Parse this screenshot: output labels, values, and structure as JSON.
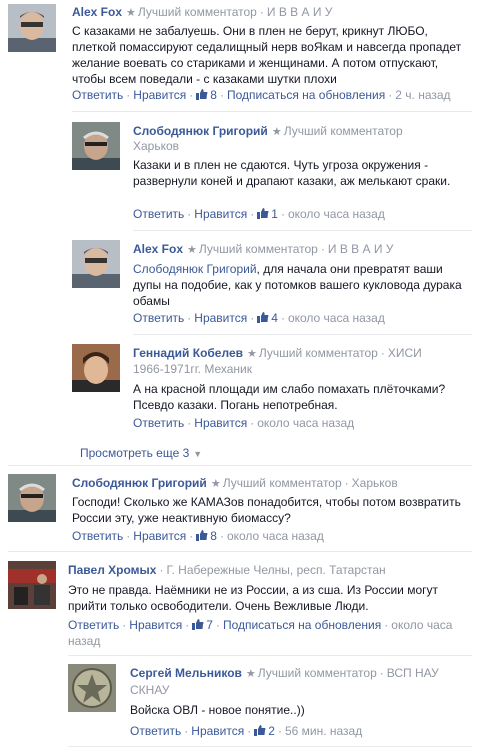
{
  "common": {
    "reply": "Ответить",
    "like": "Нравится",
    "subscribe": "Подписаться на обновления",
    "top_commenter": "Лучший комментатор",
    "dot": "·"
  },
  "comments": [
    {
      "name": "Alex Fox",
      "affiliation": "И В В А И У",
      "text": "С казаками не забалуешь. Они в плен не берут, крикнут ЛЮБО, плеткой помассируют седалищный нерв воЯкам и навсегда пропадет желание воевать со стариками и женщинами. А потом отпускают, чтобы всем поведали - с казаками шутки плохи",
      "likes": "8",
      "time": "2 ч. назад",
      "replies": [
        {
          "name": "Слободянюк Григорий",
          "location": "Харьков",
          "text": "Казаки и в плен не сдаются. Чуть угроза окружения - развернули коней и драпают казаки, аж мелькают сраки.",
          "likes": "1",
          "time": "около часа назад"
        },
        {
          "name": "Alex Fox",
          "affiliation": "И В В А И У",
          "mention": "Слободянюк Григорий",
          "text": ", для начала они превратят ваши дупы на подобие, как у потомков вашего кукловода дурака обамы",
          "likes": "4",
          "time": "около часа назад"
        },
        {
          "name": "Геннадий Кобелев",
          "affiliation": "ХИСИ",
          "subline": "1966-1971гг. Механик",
          "text": "А на красной площади им слабо помахать плёточками? Псевдо казаки. Погань непотребная.",
          "time": "около часа назад"
        }
      ],
      "more": "Просмотреть еще 3"
    },
    {
      "name": "Слободянюк Григорий",
      "location": "Харьков",
      "text": "Господи! Сколько же КАМАЗов понадобится, чтобы потом возвратить России эту, уже неактивную биомассу?",
      "likes": "8",
      "time": "около часа назад"
    },
    {
      "name": "Павел Хромых",
      "location": "Г. Набережные Челны, респ. Татарстан",
      "text": "Это не правда. Наёмники не из России, а из сша. Из России могут прийти только освободители. Очень Вежливые Люди.",
      "likes": "7",
      "time_part1": "около часа",
      "time_part2": "назад",
      "replies": [
        {
          "name": "Сергей Мельников",
          "affiliation_part1": "ВСП НАУ",
          "affiliation_part2": "СКНАУ",
          "text": "Войска ОВЛ - новое понятие..))",
          "likes": "2",
          "time": "56 мин. назад"
        }
      ]
    }
  ]
}
